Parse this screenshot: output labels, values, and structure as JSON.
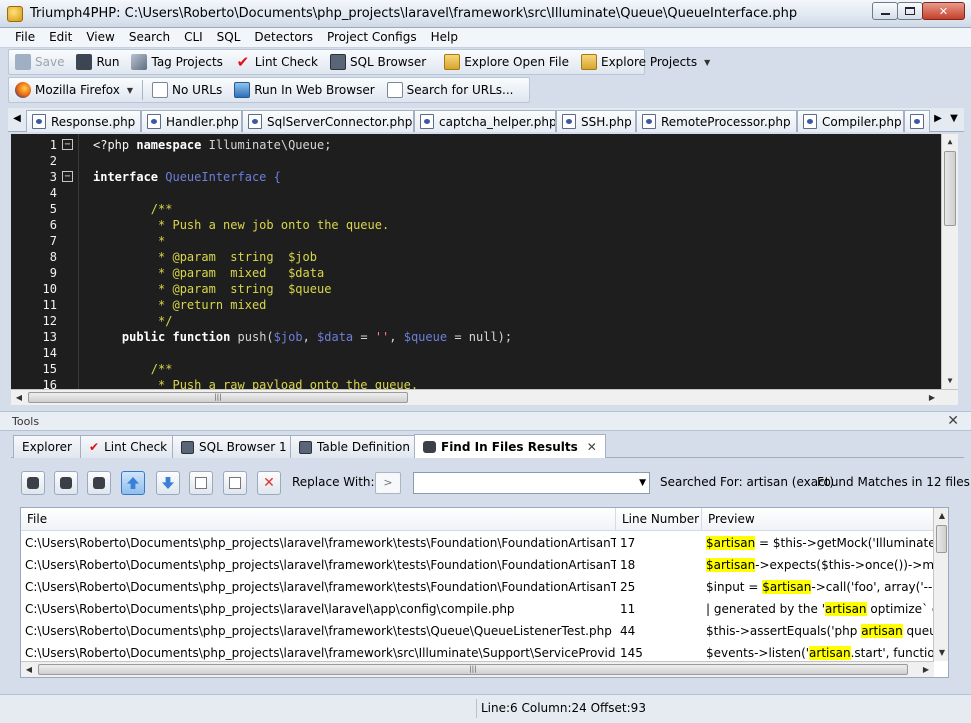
{
  "window": {
    "title": "Triumph4PHP: C:\\Users\\Roberto\\Documents\\php_projects\\laravel\\framework\\src\\Illuminate\\Queue\\QueueInterface.php",
    "icons": {
      "app": "trophy-icon",
      "minimize": "minimize-icon",
      "maximize": "maximize-icon",
      "close": "close-icon"
    },
    "close_glyph": "✕"
  },
  "menu": [
    "File",
    "Edit",
    "View",
    "Search",
    "CLI",
    "SQL",
    "Detectors",
    "Project Configs",
    "Help"
  ],
  "toolbar": {
    "save": "Save",
    "run": "Run",
    "tag_projects": "Tag Projects",
    "lint_check": "Lint Check",
    "sql_browser": "SQL Browser",
    "explore_open_file": "Explore Open File",
    "explore_projects": "Explore Projects"
  },
  "browser_toolbar": {
    "browser": "Mozilla Firefox",
    "urls": "No URLs",
    "run_in_browser": "Run In Web Browser",
    "search_urls": "Search for URLs..."
  },
  "file_tabs": [
    "Response.php",
    "Handler.php",
    "SqlServerConnector.php",
    "captcha_helper.php",
    "SSH.php",
    "RemoteProcessor.php",
    "Compiler.php"
  ],
  "code_lines": [
    {
      "n": "1",
      "fold": "−"
    },
    {
      "n": "2"
    },
    {
      "n": "3",
      "fold": "−"
    },
    {
      "n": "4"
    },
    {
      "n": "5",
      "text": "        /**"
    },
    {
      "n": "6",
      "text": "         * Push a new job onto the queue."
    },
    {
      "n": "7",
      "text": "         *"
    },
    {
      "n": "8",
      "text": "         * @param  string  $job"
    },
    {
      "n": "9",
      "text": "         * @param  mixed   $data"
    },
    {
      "n": "10",
      "text": "         * @param  string  $queue"
    },
    {
      "n": "11",
      "text": "         * @return mixed"
    },
    {
      "n": "12",
      "text": "         */"
    },
    {
      "n": "13"
    },
    {
      "n": "14"
    },
    {
      "n": "15",
      "text": "        /**"
    },
    {
      "n": "16",
      "text": "         * Push a raw payload onto the queue."
    }
  ],
  "code_parts": {
    "php_open": "<?php ",
    "namespace_kw": "namespace",
    "namespace_name": " Illuminate\\Queue;",
    "interface_kw": "interface",
    "interface_name": " QueueInterface {",
    "public_kw": "public",
    "function_kw": "function",
    "push_open": " push(",
    "var_job": "$job",
    "comma1": ", ",
    "var_data": "$data",
    "eq": " = ",
    "empty_str": "''",
    "comma2": ", ",
    "var_queue": "$queue",
    "null_end": " = null);"
  },
  "tools": {
    "title": "Tools",
    "close": "✕",
    "tabs": [
      {
        "label": "Explorer"
      },
      {
        "label": "Lint Check"
      },
      {
        "label": "SQL Browser 1"
      },
      {
        "label": "Table Definition"
      },
      {
        "label": "Find In Files Results",
        "close": "✕"
      }
    ]
  },
  "find": {
    "replace_label": "Replace With:",
    "go": ">",
    "replace_value": "",
    "searched_for": "Searched For: artisan (exact)",
    "found": "Found Matches in 12 files"
  },
  "results": {
    "columns": [
      "File",
      "Line Number",
      "Preview"
    ],
    "rows": [
      {
        "file": "C:\\Users\\Roberto\\Documents\\php_projects\\laravel\\framework\\tests\\Foundation\\FoundationArtisanTest.php",
        "line": "17",
        "pre": "",
        "match": "$artisan",
        "post": " = $this->getMock('Illuminate\\Foun"
      },
      {
        "file": "C:\\Users\\Roberto\\Documents\\php_projects\\laravel\\framework\\tests\\Foundation\\FoundationArtisanTest.php",
        "line": "18",
        "pre": "",
        "match": "$artisan",
        "post": "->expects($this->once())->method"
      },
      {
        "file": "C:\\Users\\Roberto\\Documents\\php_projects\\laravel\\framework\\tests\\Foundation\\FoundationArtisanTest.php",
        "line": "25",
        "pre": "$input = ",
        "match": "$artisan",
        "post": "->call('foo', array('--bar' ="
      },
      {
        "file": "C:\\Users\\Roberto\\Documents\\php_projects\\laravel\\laravel\\app\\config\\compile.php",
        "line": "11",
        "pre": "| generated by the '",
        "match": "artisan",
        "post": " optimize` comma"
      },
      {
        "file": "C:\\Users\\Roberto\\Documents\\php_projects\\laravel\\framework\\tests\\Queue\\QueueListenerTest.php",
        "line": "44",
        "pre": "$this->assertEquals('php ",
        "match": "artisan",
        "post": " queue:wor"
      },
      {
        "file": "C:\\Users\\Roberto\\Documents\\php_projects\\laravel\\framework\\src\\Illuminate\\Support\\ServiceProvider.php",
        "line": "145",
        "pre": "$events->listen('",
        "match": "artisan",
        "post": ".start', function($art"
      }
    ]
  },
  "status": {
    "position": "Line:6 Column:24 Offset:93"
  },
  "glyphs": {
    "left": "◀",
    "right": "▶",
    "up": "▲",
    "down": "▼",
    "dropdown": "▼",
    "grip": "|||"
  },
  "colors": {
    "editor_bg": "#1e1e1e",
    "comment": "#d8d64a",
    "variable": "#6d7fd8",
    "string": "#ff7f7f",
    "highlight": "#ffff00"
  }
}
